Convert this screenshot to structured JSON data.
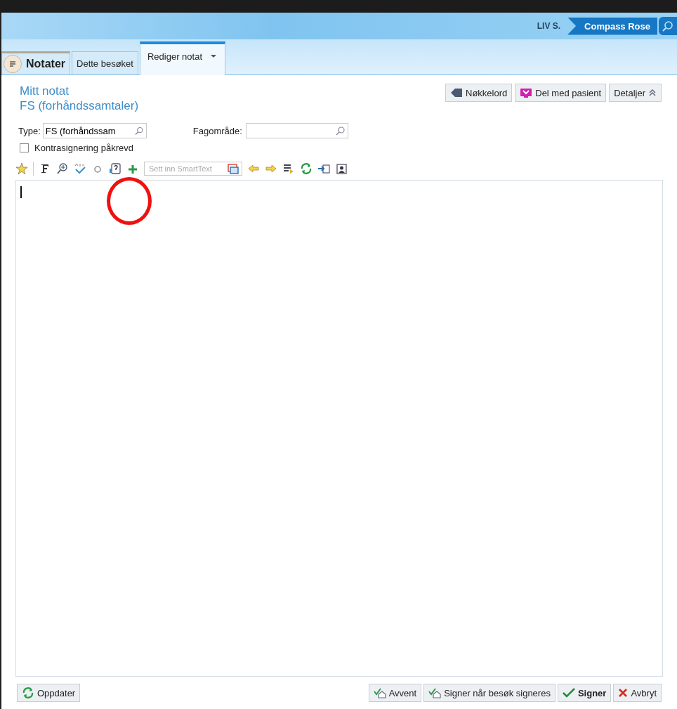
{
  "header": {
    "user": "LIV S.",
    "location": "Compass Rose"
  },
  "tabs": [
    {
      "label": "Notater",
      "kind": "menu",
      "selected": false
    },
    {
      "label": "Dette besøket",
      "kind": "plain",
      "selected": false
    },
    {
      "label": "Rediger notat",
      "kind": "dropdown",
      "selected": true
    }
  ],
  "note": {
    "title": "Mitt notat",
    "subtitle": "FS (forhåndssamtaler)"
  },
  "header_buttons": [
    {
      "label": "Nøkkelord",
      "kind": "tag"
    },
    {
      "label": "Del med pasient",
      "kind": "share"
    },
    {
      "label": "Detaljer",
      "kind": "collapse"
    }
  ],
  "type_field": {
    "label": "Type:",
    "value": "FS (forhåndssam"
  },
  "area_field": {
    "label": "Fagområde:"
  },
  "cosign": {
    "label": "Kontrasignering påkrevd",
    "checked": false
  },
  "smarttext": {
    "placeholder": "Sett inn SmartText"
  },
  "footer_left": [
    {
      "label": "Oppdater",
      "kind": "refresh"
    }
  ],
  "footer_right": [
    {
      "label": "Avvent",
      "kind": "pending"
    },
    {
      "label": "Signer når besøk signeres",
      "kind": "pending"
    },
    {
      "label": "Signer",
      "kind": "check"
    },
    {
      "label": "Avbryt",
      "kind": "cancel"
    }
  ]
}
